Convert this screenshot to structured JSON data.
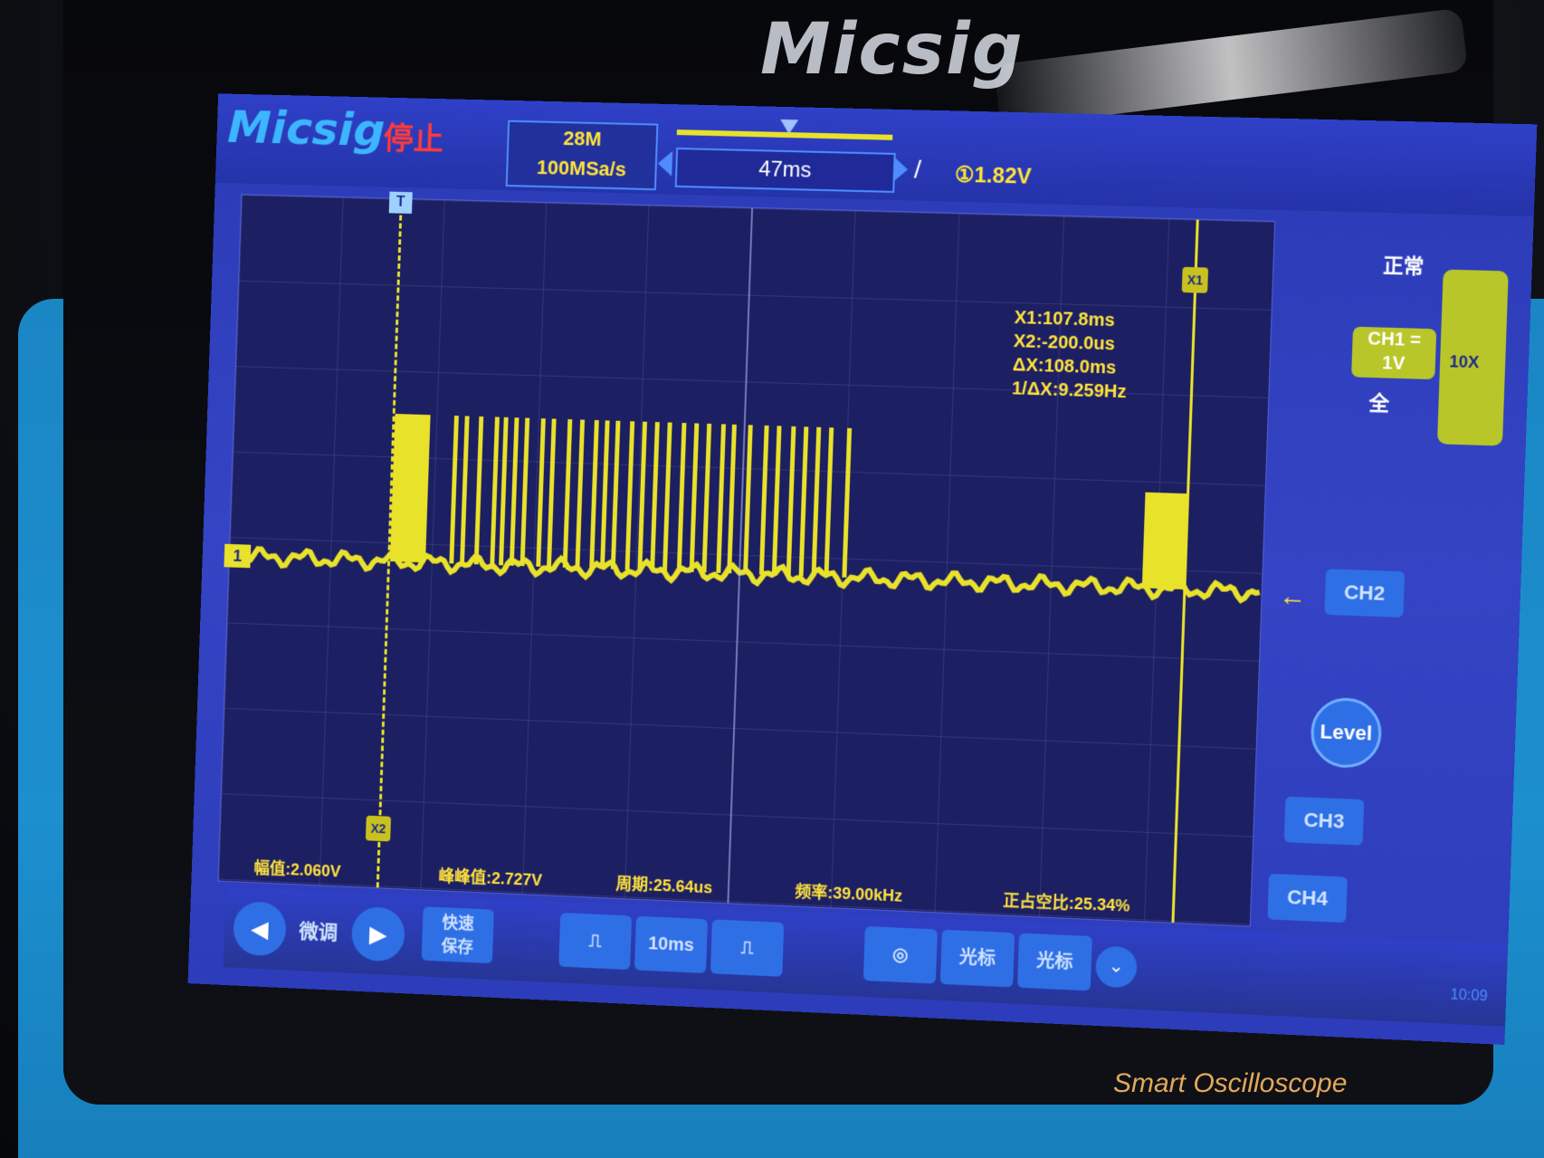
{
  "device": {
    "brand_bezel": "Micsig",
    "brand_bottom": "Smart Oscilloscope"
  },
  "screen": {
    "logo": "Micsig",
    "run_status": "停止",
    "memory_depth": "28M",
    "sample_rate": "100MSa/s",
    "horizontal_position": "47ms",
    "trigger_edge": "/",
    "trigger_level": "①1.82V"
  },
  "cursors": {
    "x1_tag": "X1",
    "x2_tag": "X2",
    "trigger_tag": "T",
    "ch1_marker": "1",
    "readout": [
      "X1:107.8ms",
      "X2:-200.0us",
      "ΔX:108.0ms",
      "1/ΔX:9.259Hz"
    ]
  },
  "measurements": [
    "幅值:2.060V",
    "峰峰值:2.727V",
    "周期:25.64us",
    "频率:39.00kHz",
    "正占空比:25.34%"
  ],
  "right_panel": {
    "trigger_mode": "正常",
    "ch1_label": "CH1",
    "ch1_scale": "1V",
    "ch1_coupling": "=",
    "bandwidth": "全",
    "probe": "10X",
    "ch2": "CH2",
    "level": "Level",
    "ch3": "CH3",
    "ch4": "CH4"
  },
  "toolbar": {
    "fine_tune": "微调",
    "quick_save": "快速\n保存",
    "timebase": "10ms",
    "cursor_h": "光标",
    "cursor_v": "光标",
    "clock": "10:09"
  },
  "colors": {
    "trace": "#e9e22a",
    "screen_bg": "#2b3bb6",
    "grid_bg": "#1d1f63",
    "status_red": "#ff3b3b"
  }
}
